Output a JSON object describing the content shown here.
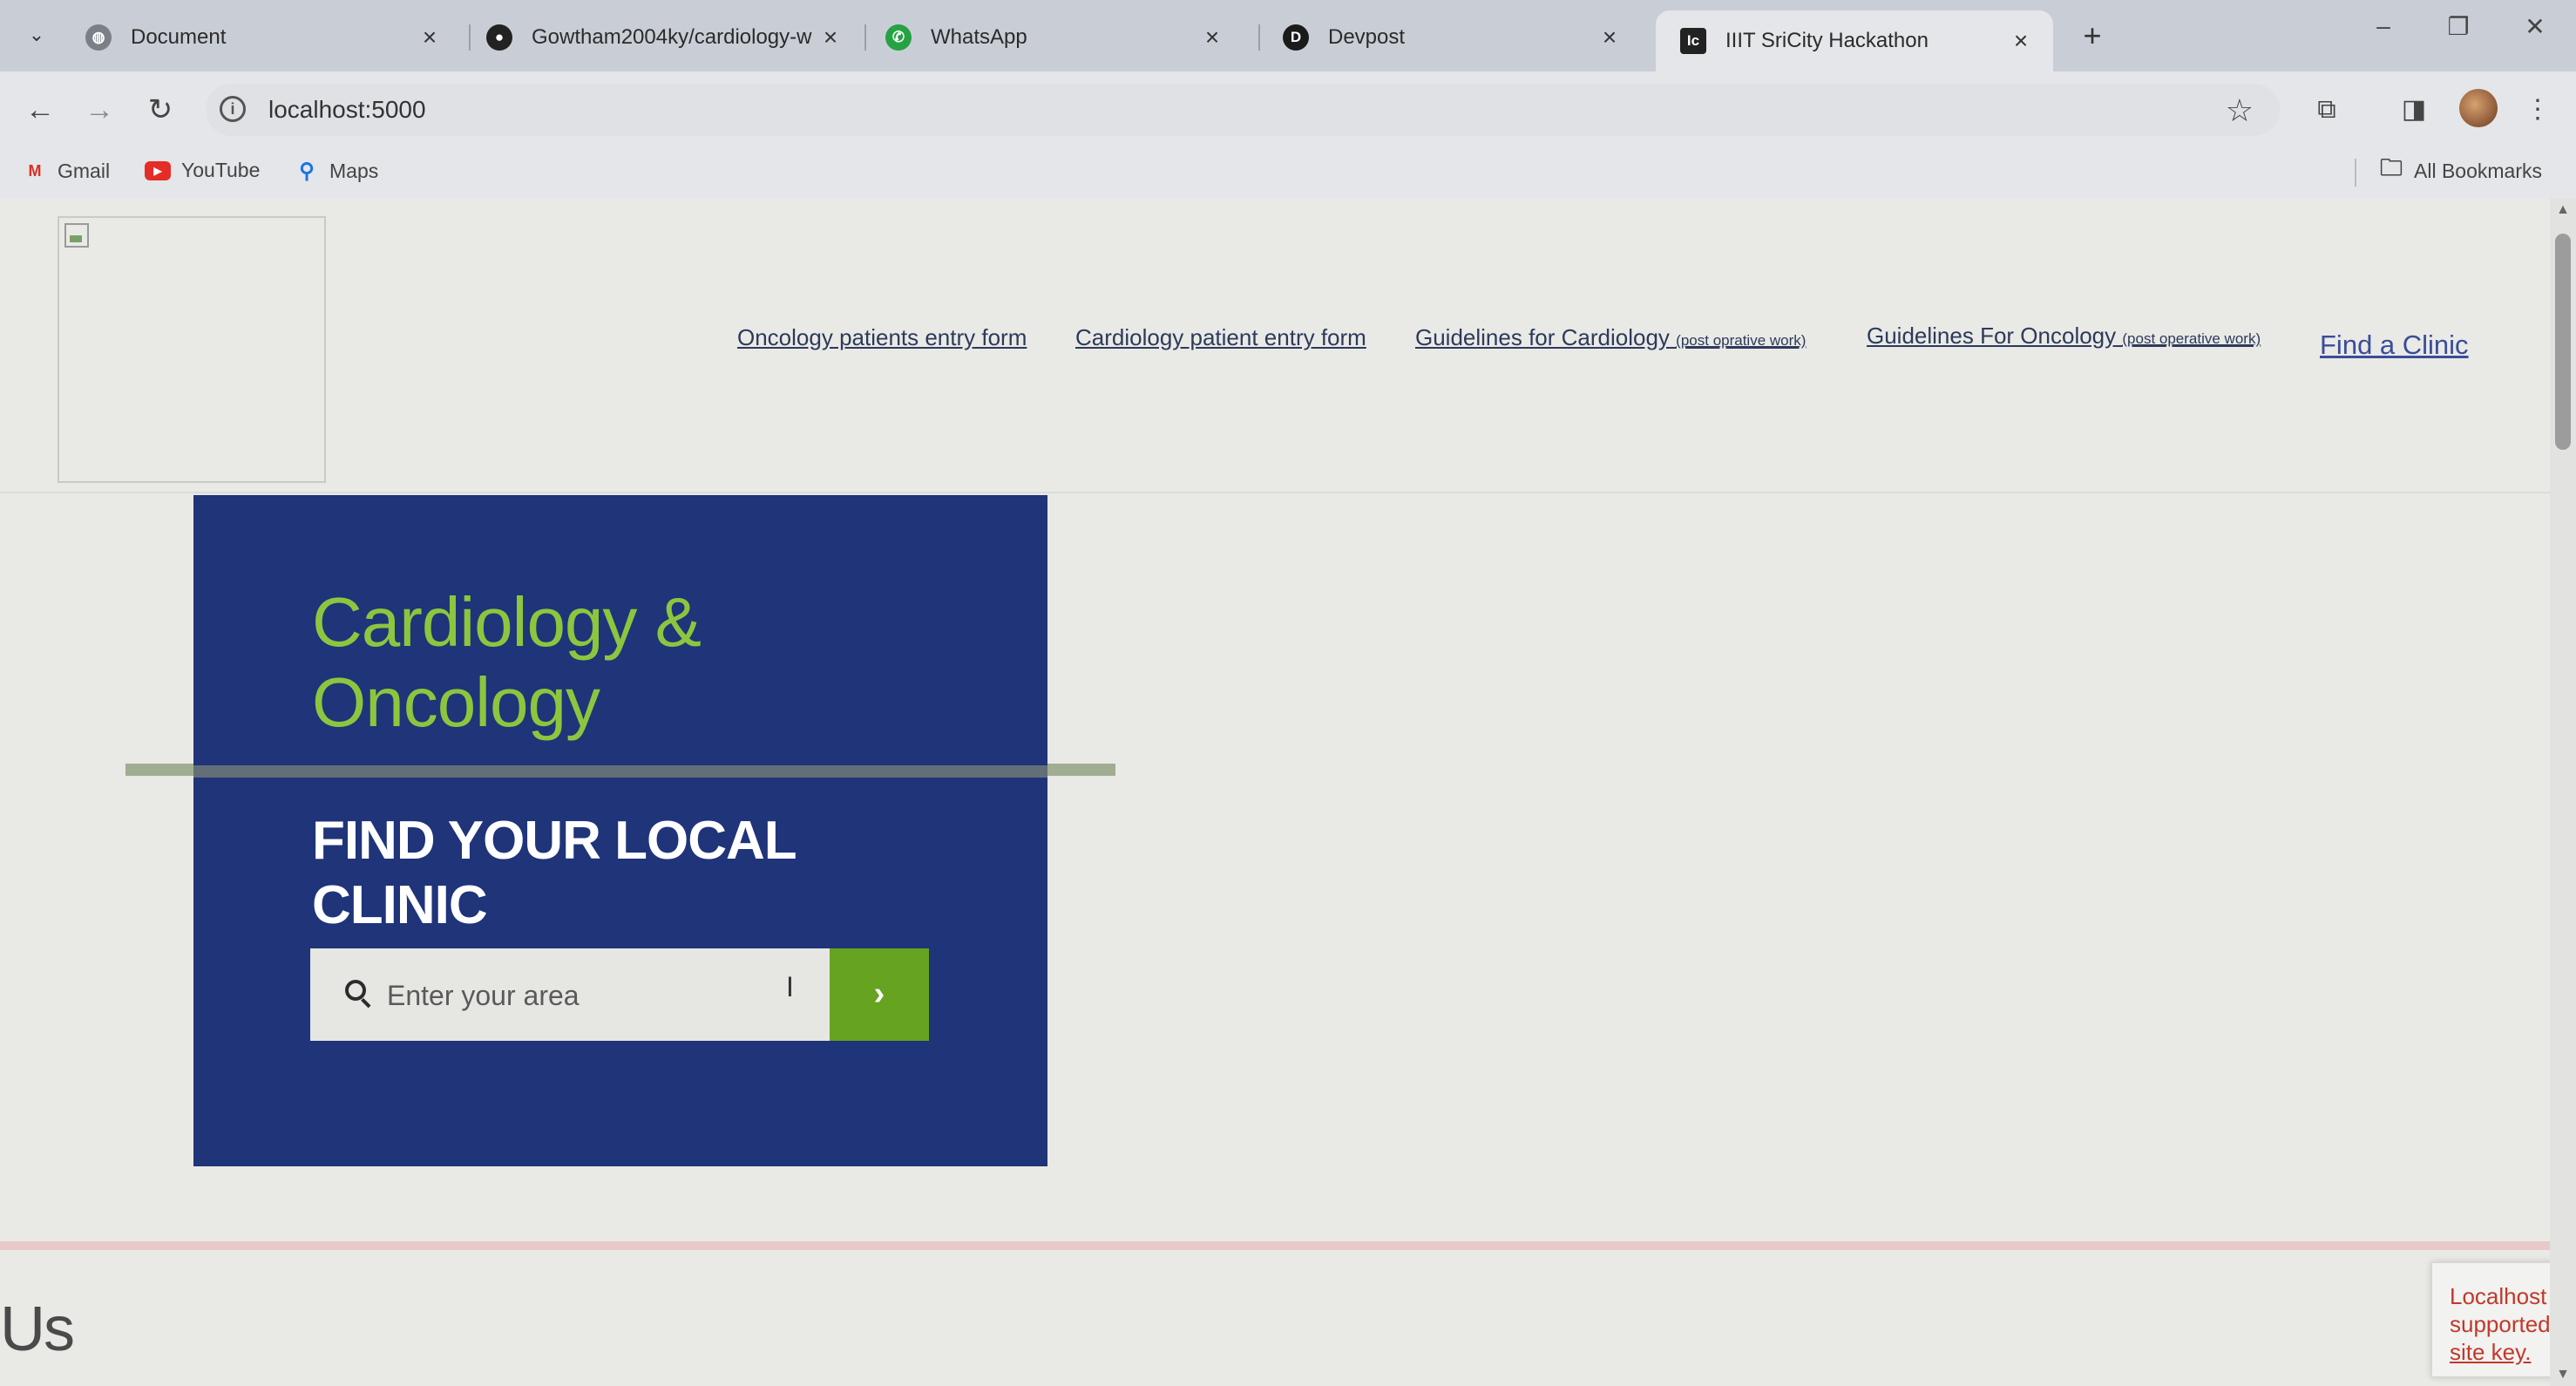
{
  "browser": {
    "tabs": [
      {
        "title": "Document",
        "icon": "globe-icon",
        "close": "×",
        "active": false
      },
      {
        "title": "Gowtham2004ky/cardiology-w",
        "icon": "github-icon",
        "close": "×",
        "active": false
      },
      {
        "title": "WhatsApp",
        "icon": "whatsapp-icon",
        "close": "×",
        "active": false
      },
      {
        "title": "Devpost",
        "icon": "devpost-icon",
        "close": "×",
        "active": false
      },
      {
        "title": "IIIT SriCity Hackathon",
        "icon": "ic-icon",
        "close": "×",
        "active": true
      }
    ],
    "new_tab": "+",
    "url": "localhost:5000",
    "bookmarks": [
      {
        "label": "Gmail",
        "icon": "gmail-icon"
      },
      {
        "label": "YouTube",
        "icon": "youtube-icon"
      },
      {
        "label": "Maps",
        "icon": "maps-pin-icon"
      }
    ],
    "all_bookmarks": "All Bookmarks"
  },
  "nav": {
    "links": [
      {
        "label": "Oncology patients entry form",
        "note": ""
      },
      {
        "label": "Cardiology patient entry form",
        "note": ""
      },
      {
        "label": "Guidelines for Cardiology",
        "note": "(post oprative work)"
      },
      {
        "label": "Guidelines For Oncology",
        "note": "(post operative work)"
      }
    ],
    "find_clinic": "Find a Clinic"
  },
  "hero": {
    "title_line1": "Cardiology &",
    "title_line2": "Oncology",
    "subtitle_line1": "FIND YOUR LOCAL",
    "subtitle_line2": "CLINIC",
    "search_placeholder": "Enter your area",
    "go": "›"
  },
  "footer": {
    "partial_heading": "Us",
    "recaptcha_line1": "Localhost",
    "recaptcha_line2": "supported",
    "recaptcha_line3": "site key."
  },
  "colors": {
    "hero_bg": "#1f3479",
    "hero_title": "#8cc63e",
    "go_button": "#66a320",
    "link": "#2c3a5a",
    "find_clinic": "#3a4c9a"
  }
}
